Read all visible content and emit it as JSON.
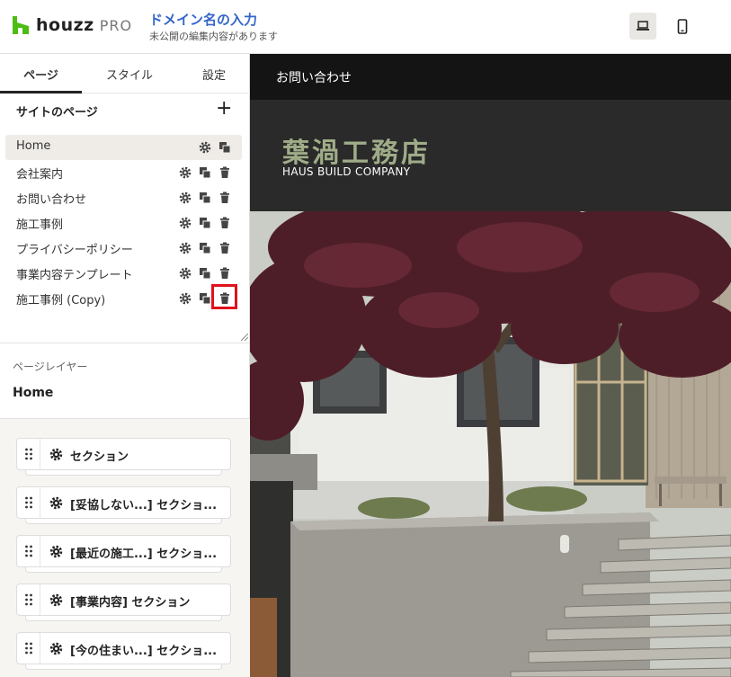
{
  "header": {
    "logo_word": "houzz",
    "logo_pro": "PRO",
    "domain_title": "ドメイン名の入力",
    "domain_subtitle": "未公開の編集内容があります",
    "devices": [
      {
        "icon": "laptop-icon",
        "active": true
      },
      {
        "icon": "mobile-icon",
        "active": false
      }
    ]
  },
  "sidebar": {
    "tabs": [
      {
        "label": "ページ",
        "active": true
      },
      {
        "label": "スタイル",
        "active": false
      },
      {
        "label": "設定",
        "active": false
      }
    ],
    "pages_heading": "サイトのページ",
    "add_label": "+",
    "pages": [
      {
        "label": "Home",
        "selected": true
      },
      {
        "label": "会社案内"
      },
      {
        "label": "お問い合わせ"
      },
      {
        "label": "施工事例"
      },
      {
        "label": "プライバシーポリシー"
      },
      {
        "label": "事業内容テンプレート"
      },
      {
        "label": "施工事例 (Copy)",
        "highlight_delete": true
      }
    ],
    "layer_heading": "ページレイヤー",
    "layer_page": "Home",
    "sections": [
      "セクション",
      "[妥協しない...] セクショ...",
      "[最近の施工...] セクショ...",
      "[事業内容] セクション",
      "[今の住まい...] セクショ..."
    ]
  },
  "preview": {
    "nav_link": "お問い合わせ",
    "brand_jp": "葉渦工務店",
    "brand_en": "HAUS BUILD COMPANY"
  },
  "colors": {
    "accent": "#3466c8",
    "brand_green": "#9fac88",
    "houzz_green": "#4dbc15",
    "highlight_red": "#e0121b"
  }
}
